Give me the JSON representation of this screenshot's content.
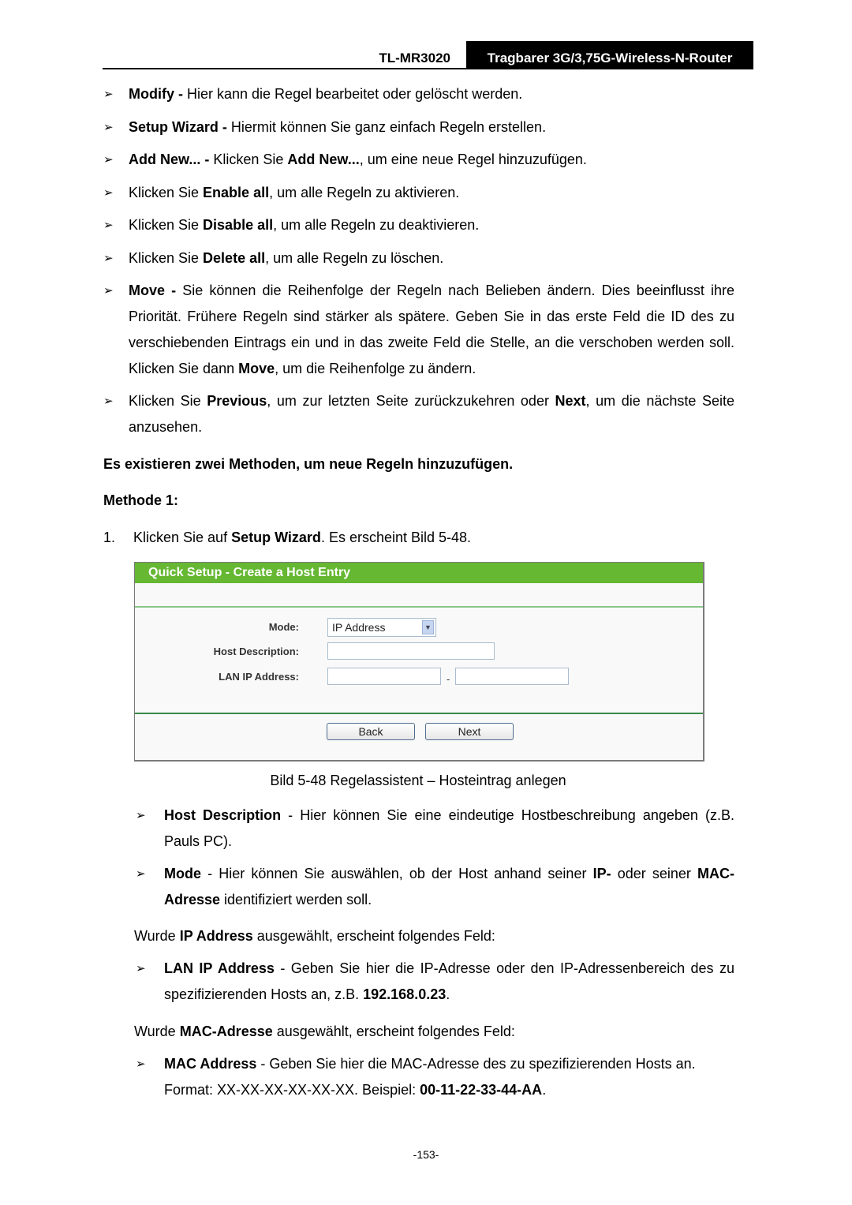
{
  "header": {
    "model": "TL-MR3020",
    "title": "Tragbarer 3G/3,75G-Wireless-N-Router"
  },
  "bullet_glyph": "➢",
  "bullets_top": [
    {
      "bold": "Modify -",
      "text": " Hier kann die Regel bearbeitet oder gelöscht werden."
    },
    {
      "bold": "Setup Wizard -",
      "text": " Hiermit können Sie ganz einfach Regeln erstellen."
    },
    {
      "bold": "Add New... -",
      "text": " Klicken Sie ",
      "bold2": "Add New...",
      "text2": ", um eine neue Regel hinzuzufügen."
    },
    {
      "pre": "Klicken Sie ",
      "bold": "Enable all",
      "text": ", um alle Regeln zu aktivieren."
    },
    {
      "pre": "Klicken Sie ",
      "bold": "Disable all",
      "text": ", um alle Regeln zu deaktivieren."
    },
    {
      "pre": "Klicken Sie ",
      "bold": "Delete all",
      "text": ", um alle Regeln zu löschen."
    },
    {
      "bold": "Move -",
      "text": " Sie können die Reihenfolge der Regeln nach Belieben ändern. Dies beeinflusst ihre Priorität. Frühere Regeln sind stärker als spätere. Geben Sie in das erste Feld die ID des zu verschiebenden Eintrags ein und in das zweite Feld die Stelle, an die verschoben werden soll. Klicken Sie dann ",
      "bold2": "Move",
      "text2": ", um die Reihenfolge zu ändern."
    },
    {
      "pre": "Klicken Sie ",
      "bold": "Previous",
      "text": ", um zur letzten Seite zurückzukehren oder ",
      "bold2": "Next",
      "text2": ", um die nächste Seite anzusehen."
    }
  ],
  "section_heading": "Es existieren zwei Methoden, um neue Regeln hinzuzufügen.",
  "method_heading": "Methode 1:",
  "step1": {
    "num": "1.",
    "pre": "Klicken Sie auf ",
    "bold": "Setup Wizard",
    "text": ". Es erscheint Bild 5-48."
  },
  "screenshot": {
    "title": "Quick Setup - Create a Host Entry",
    "mode_label": "Mode:",
    "mode_value": "IP Address",
    "arrow_glyph": "▼",
    "host_desc_label": "Host Description:",
    "host_desc_value": "",
    "lan_ip_label": "LAN IP Address:",
    "lan_ip_from": "",
    "lan_ip_to": "",
    "range_dash": "-",
    "back_label": "Back",
    "next_label": "Next"
  },
  "caption": "Bild 5-48 Regelassistent – Hosteintrag anlegen",
  "bullets_mid": [
    {
      "bold": "Host Description",
      "text": " - Hier können Sie eine eindeutige Hostbeschreibung angeben (z.B. Pauls PC)."
    },
    {
      "bold": "Mode",
      "text": " - Hier können Sie auswählen, ob der Host anhand seiner ",
      "bold2": "IP-",
      "text2": " oder seiner ",
      "bold3": "MAC-Adresse",
      "text3": " identifiziert werden soll."
    }
  ],
  "ip_intro": {
    "pre": "Wurde ",
    "bold": "IP Address",
    "text": " ausgewählt, erscheint folgendes Feld:"
  },
  "bullet_lanip": {
    "bold": "LAN IP Address",
    "text": " - Geben Sie hier die IP-Adresse oder den IP-Adressenbereich des zu spezifizierenden Hosts an, z.B. ",
    "bold2": "192.168.0.23",
    "text2": "."
  },
  "mac_intro": {
    "pre": "Wurde ",
    "bold": "MAC-Adresse",
    "text": " ausgewählt, erscheint folgendes Feld:"
  },
  "bullet_mac": {
    "bold": "MAC Address",
    "text": " - Geben Sie hier die MAC-Adresse des zu spezifizierenden Hosts an. Format: XX-XX-XX-XX-XX-XX. Beispiel: ",
    "bold2": "00-11-22-33-44-AA",
    "text2": "."
  },
  "page_number": "-153-"
}
